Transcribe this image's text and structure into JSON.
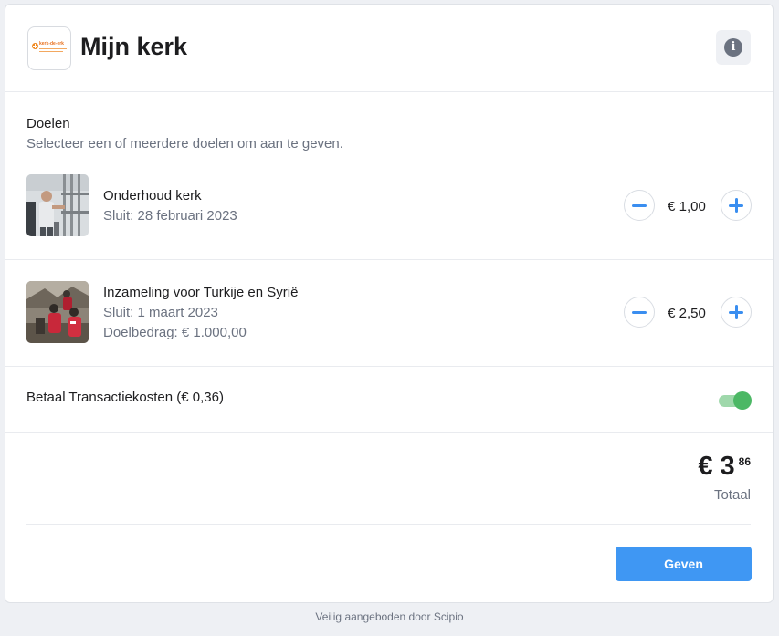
{
  "header": {
    "logo_text": "kerk-de-erk",
    "title": "Mijn kerk",
    "info_icon": "info-icon"
  },
  "goals_section": {
    "title": "Doelen",
    "subtitle": "Selecteer een of meerdere doelen om aan te geven."
  },
  "goals": [
    {
      "name": "Onderhoud kerk",
      "closes": "Sluit: 28 februari 2023",
      "target": "",
      "amount": "€ 1,00"
    },
    {
      "name": "Inzameling voor Turkije en Syrië",
      "closes": "Sluit: 1 maart 2023",
      "target": "Doelbedrag: € 1.000,00",
      "amount": "€ 2,50"
    }
  ],
  "fees": {
    "label": "Betaal Transactiekosten (€ 0,36)",
    "enabled": true
  },
  "total": {
    "main": "€ 3",
    "cents": "86",
    "label": "Totaal"
  },
  "actions": {
    "give_label": "Geven"
  },
  "footer": {
    "text": "Veilig aangeboden door Scipio"
  },
  "colors": {
    "accent": "#3f97f3",
    "toggle_on": "#4cb865"
  }
}
